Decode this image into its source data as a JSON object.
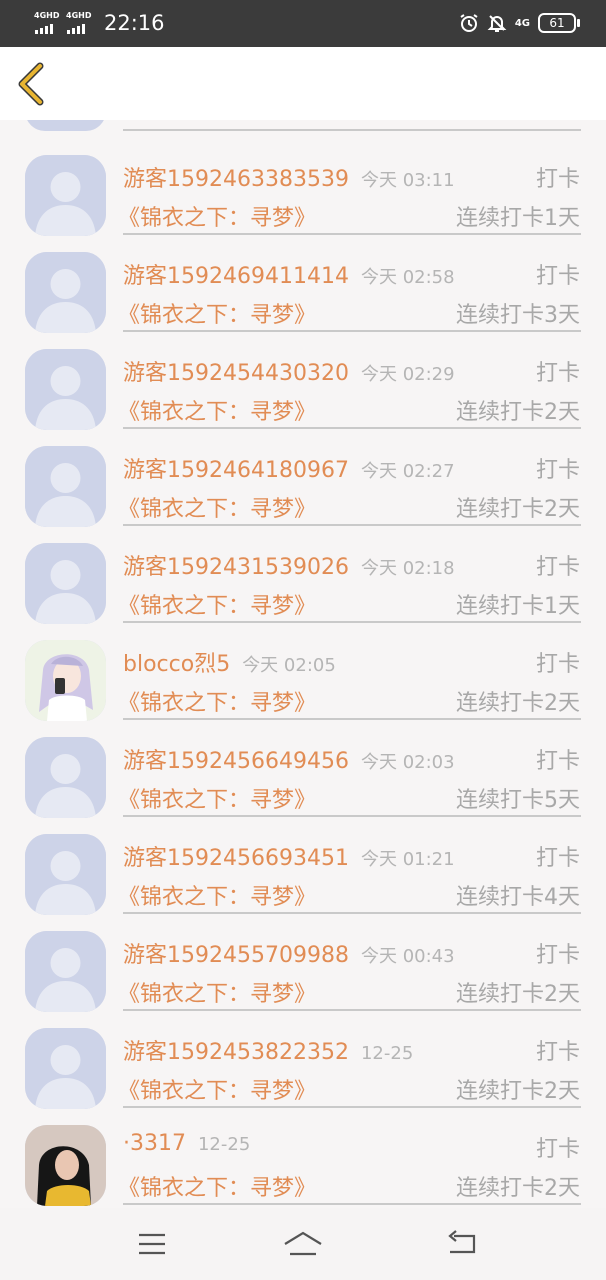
{
  "status_bar": {
    "signal1_label": "4GHD",
    "signal2_label": "4GHD",
    "time": "22:16",
    "net_label": "4G",
    "battery": "61"
  },
  "entries": [
    {
      "name": "游客1592463383539",
      "time": "今天 03:11",
      "action": "打卡",
      "book": "《锦衣之下：寻梦》",
      "streak": "连续打卡1天",
      "avatar": "default"
    },
    {
      "name": "游客1592469411414",
      "time": "今天 02:58",
      "action": "打卡",
      "book": "《锦衣之下：寻梦》",
      "streak": "连续打卡3天",
      "avatar": "default"
    },
    {
      "name": "游客1592454430320",
      "time": "今天 02:29",
      "action": "打卡",
      "book": "《锦衣之下：寻梦》",
      "streak": "连续打卡2天",
      "avatar": "default"
    },
    {
      "name": "游客1592464180967",
      "time": "今天 02:27",
      "action": "打卡",
      "book": "《锦衣之下：寻梦》",
      "streak": "连续打卡2天",
      "avatar": "default"
    },
    {
      "name": "游客1592431539026",
      "time": "今天 02:18",
      "action": "打卡",
      "book": "《锦衣之下：寻梦》",
      "streak": "连续打卡1天",
      "avatar": "default"
    },
    {
      "name": "blocco烈5",
      "time": "今天 02:05",
      "action": "打卡",
      "book": "《锦衣之下：寻梦》",
      "streak": "连续打卡2天",
      "avatar": "anime"
    },
    {
      "name": "游客1592456649456",
      "time": "今天 02:03",
      "action": "打卡",
      "book": "《锦衣之下：寻梦》",
      "streak": "连续打卡5天",
      "avatar": "default"
    },
    {
      "name": "游客1592456693451",
      "time": "今天 01:21",
      "action": "打卡",
      "book": "《锦衣之下：寻梦》",
      "streak": "连续打卡4天",
      "avatar": "default"
    },
    {
      "name": "游客1592455709988",
      "time": "今天 00:43",
      "action": "打卡",
      "book": "《锦衣之下：寻梦》",
      "streak": "连续打卡2天",
      "avatar": "default"
    },
    {
      "name": "游客1592453822352",
      "time": "12-25",
      "action": "打卡",
      "book": "《锦衣之下：寻梦》",
      "streak": "连续打卡2天",
      "avatar": "default"
    },
    {
      "name": "·3317",
      "time": "12-25",
      "action": "打卡",
      "book": "《锦衣之下：寻梦》",
      "streak": "连续打卡2天",
      "avatar": "photo"
    }
  ],
  "colors": {
    "accent": "#e18c54",
    "muted": "#a8a8a8",
    "back_arrow": "#e8b531",
    "avatar_bg": "#cdd3e8"
  },
  "icons": {
    "back": "back-chevron-icon",
    "menu": "menu-icon",
    "home": "home-icon",
    "return": "return-icon",
    "alarm": "alarm-icon",
    "mute": "bell-off-icon"
  }
}
